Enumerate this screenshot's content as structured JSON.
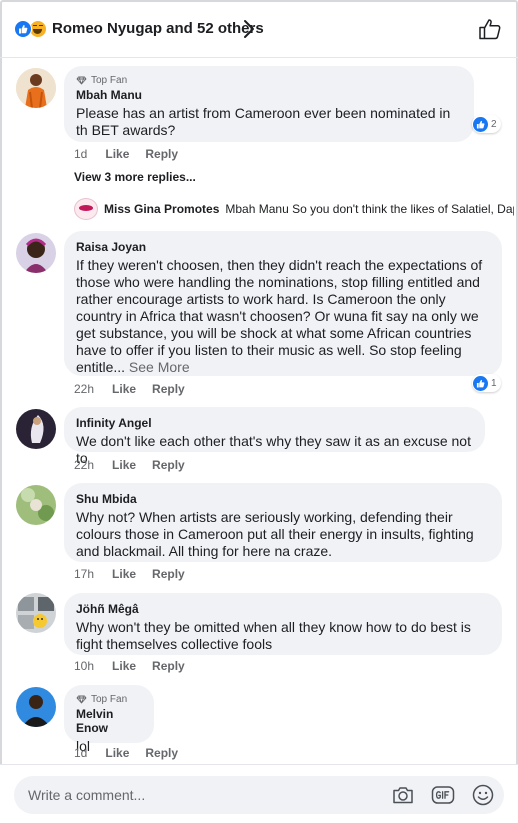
{
  "header": {
    "title": "Romeo Nyugap and 52 others",
    "reaction_icons": [
      "like-reaction-icon",
      "haha-reaction-icon"
    ]
  },
  "colors": {
    "accent": "#1877f2",
    "bubble": "#f0f2f5",
    "muted": "#65676b",
    "haha": "#f7b125"
  },
  "comments": [
    {
      "badge": "Top Fan",
      "author": "Mbah Manu",
      "text": "Please has an artist from Cameroon ever been nominated in th BET awards?",
      "time": "1d",
      "like": "Like",
      "reply": "Reply",
      "reactions": "2"
    },
    {
      "author": "Raisa Joyan",
      "text": "If they weren't choosen, then they didn't reach the expectations of those who were handling the nominations, stop filling entitled and rather encourage artists to work hard. Is Cameroon the only country in Africa that wasn't choosen? Or wuna fit say na only we get substance, you will be shock at what some African countries have to offer if you listen to their music as well. So stop feeling entitle...",
      "see_more": "See More",
      "time": "22h",
      "like": "Like",
      "reply": "Reply",
      "reactions": "1"
    },
    {
      "author": "Infinity Angel",
      "text": "We don't like each other that's why they saw it as an excuse not to",
      "time": "22h",
      "like": "Like",
      "reply": "Reply"
    },
    {
      "author": "Shu Mbida",
      "text": "Why not? When artists are seriously working, defending their colours those in Cameroon put all their energy in insults, fighting and blackmail. All thing for here na craze.",
      "time": "17h",
      "like": "Like",
      "reply": "Reply"
    },
    {
      "author": "Jöhñ Mêgâ",
      "text": "Why won't they be omitted when all they know how to do best is fight themselves collective fools",
      "time": "10h",
      "like": "Like",
      "reply": "Reply"
    },
    {
      "badge": "Top Fan",
      "author": "Melvin Enow",
      "text": "lol",
      "time": "1d",
      "like": "Like",
      "reply": "Reply"
    }
  ],
  "view_replies": "View 3 more replies...",
  "reply_preview": {
    "name": "Miss Gina Promotes",
    "text": "Mbah Manu So you don't think the likes of Salatiel, Dap..."
  },
  "composer": {
    "placeholder": "Write a comment...",
    "icons": [
      "camera-icon",
      "gif-icon",
      "emoji-icon"
    ]
  }
}
